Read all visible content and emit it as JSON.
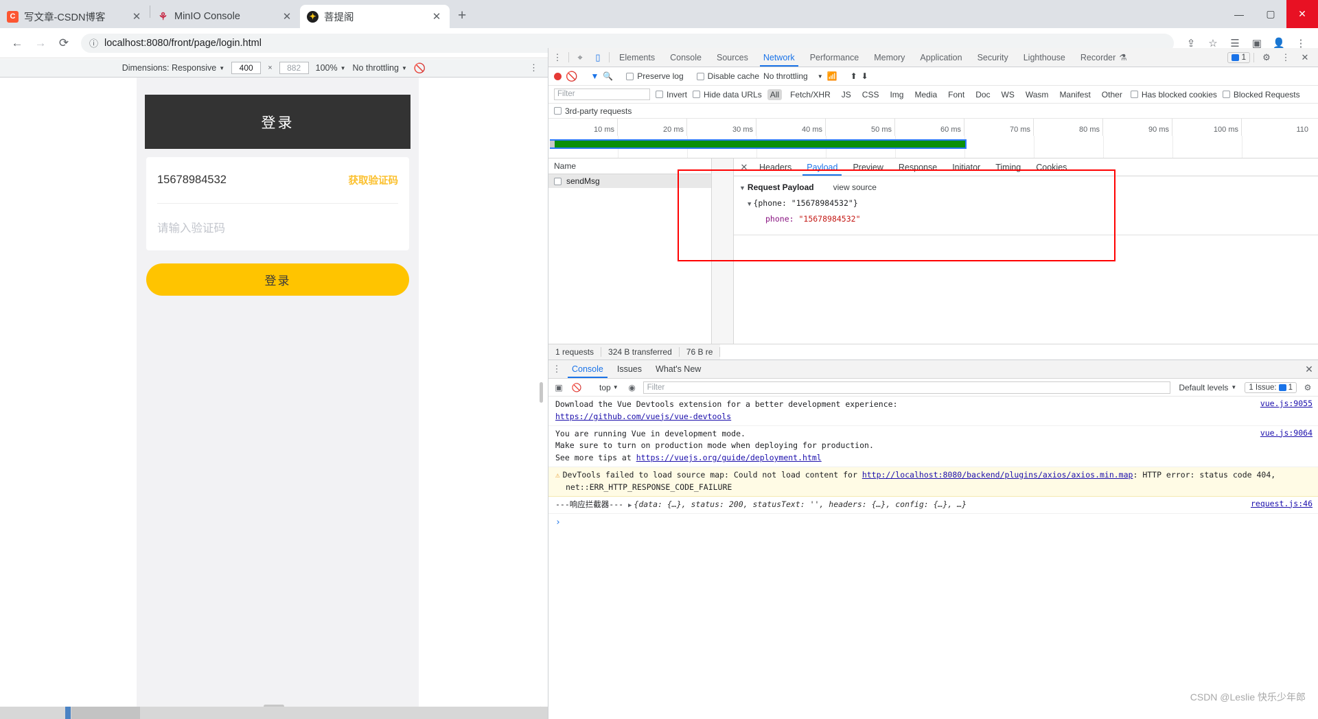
{
  "browser": {
    "tabs": [
      {
        "title": "写文章-CSDN博客",
        "favicon": "csdn-icon",
        "active": false,
        "close": "✕"
      },
      {
        "title": "MinIO Console",
        "favicon": "minio-icon",
        "active": false,
        "close": "✕"
      },
      {
        "title": "菩提阁",
        "favicon": "bodhi-icon",
        "active": true,
        "close": "✕"
      }
    ],
    "new_tab_label": "+",
    "window_controls": {
      "minimize": "—",
      "maximize": "▢",
      "close": "✕"
    },
    "nav": {
      "back": "←",
      "forward": "→",
      "reload": "⟳",
      "info": "ⓘ"
    },
    "url": "localhost:8080/front/page/login.html",
    "toolbar_icons": [
      "share-icon",
      "bookmark-star-icon",
      "reading-list-icon",
      "extensions-icon",
      "profile-icon",
      "chrome-menu-icon"
    ]
  },
  "device_toolbar": {
    "dimensions_label": "Dimensions: Responsive",
    "width": "400",
    "height": "882",
    "zoom": "100%",
    "throttling": "No throttling",
    "caret": "▼",
    "x_symbol": "×",
    "kebab": "⋮"
  },
  "login_page": {
    "header_title": "登录",
    "phone_value": "15678984532",
    "get_code_label": "获取验证码",
    "code_placeholder": "请输入验证码",
    "submit_label": "登录"
  },
  "devtools": {
    "top_tabs": [
      {
        "label": "Elements",
        "active": false
      },
      {
        "label": "Console",
        "active": false
      },
      {
        "label": "Sources",
        "active": false
      },
      {
        "label": "Network",
        "active": true
      },
      {
        "label": "Performance",
        "active": false
      },
      {
        "label": "Memory",
        "active": false
      },
      {
        "label": "Application",
        "active": false
      },
      {
        "label": "Security",
        "active": false
      },
      {
        "label": "Lighthouse",
        "active": false
      },
      {
        "label": "Recorder",
        "active": false,
        "suffix": "⚗"
      }
    ],
    "message_badge": "1",
    "gear": "⚙",
    "kebab": "⋮",
    "close": "✕",
    "inspect_icon": "⌖",
    "device_icon": "▯",
    "network_toolbar": {
      "record_title": "record",
      "clear_title": "clear",
      "filter_title": "filter",
      "search_title": "search",
      "preserve_log": "Preserve log",
      "disable_cache": "Disable cache",
      "throttling": "No throttling",
      "caret": "▼",
      "import_title": "import HAR",
      "export_title": "export HAR"
    },
    "filter_bar": {
      "filter_placeholder": "Filter",
      "invert": "Invert",
      "hide_data_urls": "Hide data URLs",
      "types": [
        "All",
        "Fetch/XHR",
        "JS",
        "CSS",
        "Img",
        "Media",
        "Font",
        "Doc",
        "WS",
        "Wasm",
        "Manifest",
        "Other"
      ],
      "active_type": "All",
      "has_blocked_cookies": "Has blocked cookies",
      "blocked_requests": "Blocked Requests",
      "third_party": "3rd-party requests"
    },
    "timeline": {
      "ticks": [
        "10 ms",
        "20 ms",
        "30 ms",
        "40 ms",
        "50 ms",
        "60 ms",
        "70 ms",
        "80 ms",
        "90 ms",
        "100 ms",
        "110"
      ]
    },
    "request_list": {
      "column_name": "Name",
      "rows": [
        {
          "name": "sendMsg"
        }
      ]
    },
    "detail": {
      "close": "✕",
      "tabs": [
        {
          "label": "Headers",
          "active": false
        },
        {
          "label": "Payload",
          "active": true
        },
        {
          "label": "Preview",
          "active": false
        },
        {
          "label": "Response",
          "active": false
        },
        {
          "label": "Initiator",
          "active": false
        },
        {
          "label": "Timing",
          "active": false
        },
        {
          "label": "Cookies",
          "active": false
        }
      ],
      "section_title": "Request Payload",
      "view_source": "view source",
      "object_line": "{phone: \"15678984532\"}",
      "key": "phone:",
      "value": "\"15678984532\"",
      "triangle": "▼"
    },
    "status_bar": {
      "requests": "1 requests",
      "transferred": "324 B transferred",
      "resources": "76 B re"
    },
    "drawer": {
      "tabs": [
        {
          "label": "Console",
          "active": true
        },
        {
          "label": "Issues",
          "active": false
        },
        {
          "label": "What's New",
          "active": false
        }
      ],
      "close": "✕",
      "kebab": "⋮",
      "context": "top",
      "caret": "▼",
      "filter_placeholder": "Filter",
      "levels": "Default levels",
      "issues_label": "1 Issue:",
      "issues_count": "1",
      "settings": "⚙",
      "logs": [
        {
          "type": "info",
          "line1": "Download the Vue Devtools extension for a better development experience:",
          "link": "https://github.com/vuejs/vue-devtools",
          "source": "vue.js:9055"
        },
        {
          "type": "info",
          "line1": "You are running Vue in development mode.",
          "line2": "Make sure to turn on production mode when deploying for production.",
          "line3_prefix": "See more tips at ",
          "link": "https://vuejs.org/guide/deployment.html",
          "source": "vue.js:9064"
        },
        {
          "type": "warning",
          "prefix": "DevTools failed to load source map: Could not load content for ",
          "link": "http://localhost:8080/backend/plugins/axios/axios.min.map",
          "suffix": ": HTTP error: status code 404,",
          "line2": "net::ERR_HTTP_RESPONSE_CODE_FAILURE",
          "source": ""
        },
        {
          "type": "object",
          "label": "---响应拦截器---",
          "expander": "▶",
          "object": "{data: {…}, status: 200, statusText: '', headers: {…}, config: {…}, …}",
          "status_num": "200",
          "source": "request.js:46"
        }
      ],
      "prompt": "›"
    }
  },
  "watermark": "CSDN @Leslie 快乐少年郎"
}
